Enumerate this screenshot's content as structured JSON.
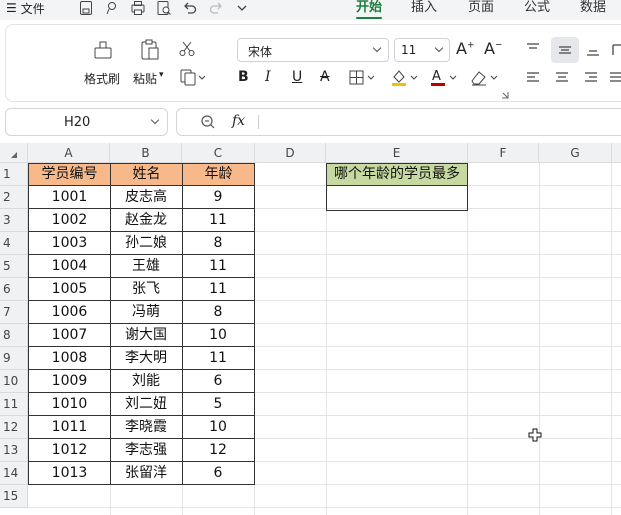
{
  "menu": {
    "file_label": "文件",
    "tabs": [
      "开始",
      "插入",
      "页面",
      "公式",
      "数据"
    ],
    "active_tab": "开始"
  },
  "ribbon": {
    "format_painter": "格式刷",
    "paste": "粘贴",
    "font_name": "宋体",
    "font_size": "11"
  },
  "formula_bar": {
    "name_box": "H20",
    "fx_label": "fx",
    "formula": ""
  },
  "sheet": {
    "columns": [
      "A",
      "B",
      "C",
      "D",
      "E",
      "F",
      "G"
    ],
    "rows": [
      "1",
      "2",
      "3",
      "4",
      "5",
      "6",
      "7",
      "8",
      "9",
      "10",
      "11",
      "12",
      "13",
      "14",
      "15"
    ],
    "headers": [
      "学员编号",
      "姓名",
      "年龄"
    ],
    "data": [
      [
        "1001",
        "皮志高",
        "9"
      ],
      [
        "1002",
        "赵金龙",
        "11"
      ],
      [
        "1003",
        "孙二娘",
        "8"
      ],
      [
        "1004",
        "王雄",
        "11"
      ],
      [
        "1005",
        "张飞",
        "11"
      ],
      [
        "1006",
        "冯萌",
        "8"
      ],
      [
        "1007",
        "谢大国",
        "10"
      ],
      [
        "1008",
        "李大明",
        "11"
      ],
      [
        "1009",
        "刘能",
        "6"
      ],
      [
        "1010",
        "刘二妞",
        "5"
      ],
      [
        "1011",
        "李晓霞",
        "10"
      ],
      [
        "1012",
        "李志强",
        "12"
      ],
      [
        "1013",
        "张留洋",
        "6"
      ]
    ],
    "question": "哪个年龄的学员最多",
    "answer": ""
  },
  "colors": {
    "accent": "#1e7f3c",
    "header_fill": "#f8b98a",
    "question_fill": "#c6d9a0",
    "font_color_bar": "#c00000"
  }
}
